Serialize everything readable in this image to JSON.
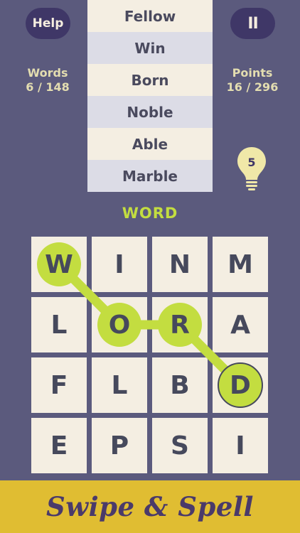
{
  "header": {
    "help_label": "Help",
    "pause_label": "II"
  },
  "stats": {
    "words_label": "Words",
    "words_value": "6 / 148",
    "points_label": "Points",
    "points_value": "16 / 296"
  },
  "found_words": [
    "Fellow",
    "Win",
    "Born",
    "Noble",
    "Able",
    "Marble"
  ],
  "hint": {
    "icon": "lightbulb-icon",
    "count": "5"
  },
  "current_word": "WORD",
  "grid": {
    "rows": [
      [
        "W",
        "I",
        "N",
        "M"
      ],
      [
        "L",
        "O",
        "R",
        "A"
      ],
      [
        "F",
        "L",
        "B",
        "D"
      ],
      [
        "E",
        "P",
        "S",
        "I"
      ]
    ],
    "selected_path": [
      [
        0,
        0
      ],
      [
        1,
        1
      ],
      [
        1,
        2
      ],
      [
        2,
        3
      ]
    ]
  },
  "banner": {
    "text": "Swipe & Spell"
  },
  "colors": {
    "background": "#5b5a7d",
    "accent_green": "#c3dd40",
    "banner_yellow": "#e0bd32",
    "button_purple": "#3f3767"
  }
}
